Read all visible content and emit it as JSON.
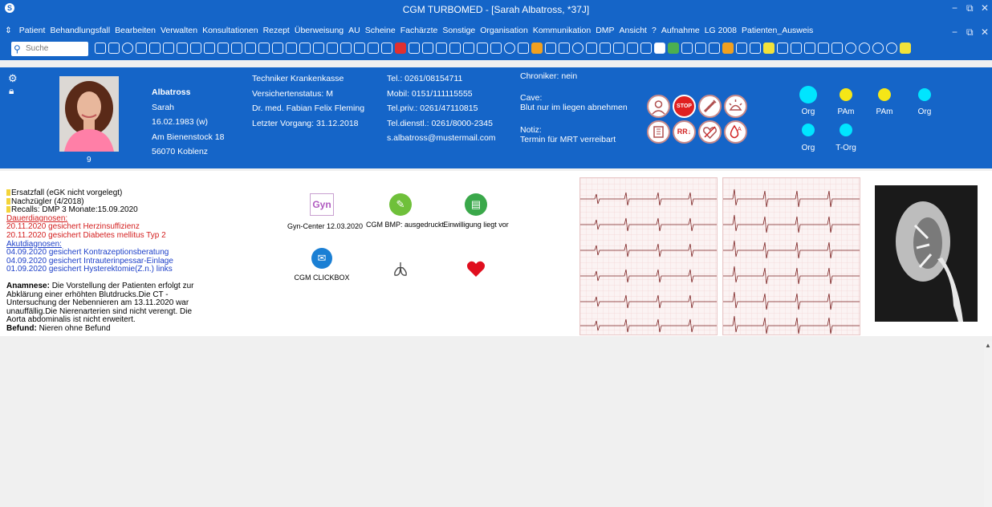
{
  "window": {
    "title": "CGM TURBOMED - [Sarah Albatross, *37J]",
    "minimize": "−",
    "restore": "⧉",
    "close": "✕"
  },
  "menu": {
    "items": [
      "Patient",
      "Behandlungsfall",
      "Bearbeiten",
      "Verwalten",
      "Konsultationen",
      "Rezept",
      "Überweisung",
      "AU",
      "Scheine",
      "Fachärzte",
      "Sonstige",
      "Organisation",
      "Kommunikation",
      "DMP",
      "Ansicht",
      "?",
      "Aufnahme",
      "LG 2008",
      "Patienten_Ausweis"
    ],
    "minimize": "−",
    "restore": "⧉",
    "close": "✕"
  },
  "toolbar": {
    "search_placeholder": "Suche"
  },
  "patient": {
    "photo_number": "9",
    "personal": {
      "surname": "Albatross",
      "firstname": "Sarah",
      "birthdate": "16.02.1983 (w)",
      "street": "Am Bienenstock 18",
      "city": "56070 Koblenz"
    },
    "insurance": {
      "company": "Techniker Krankenkasse",
      "status": "Versichertenstatus: M",
      "doctor": "Dr. med. Fabian Felix Fleming",
      "last_visit": "Letzter Vorgang: 31.12.2018"
    },
    "contact": {
      "tel": "Tel.: 0261/08154711",
      "mobile": "Mobil: 0151/111115555",
      "tel_priv": "Tel.priv.: 0261/47110815",
      "tel_dienst": "Tel.dienstl.: 0261/8000-2345",
      "email": "s.albatross@mustermail.com"
    },
    "notes": {
      "chroniker": "Chroniker: nein",
      "cave_label": "Cave:",
      "cave_text": "Blut nur im liegen abnehmen",
      "notiz_label": "Notiz:",
      "notiz_text": "Termin für MRT verreibart"
    },
    "statuses": [
      {
        "label": "Org",
        "color": "#00e5ff"
      },
      {
        "label": "PAm",
        "color": "#f5e617"
      },
      {
        "label": "PAm",
        "color": "#f5e617"
      },
      {
        "label": "Org",
        "color": "#00e5ff"
      },
      {
        "label": "Org",
        "color": "#00e5ff"
      },
      {
        "label": "T-Org",
        "color": "#00e5ff"
      }
    ],
    "indicator_icons": [
      "nurse-icon",
      "stop-icon",
      "syringe-icon",
      "sun-icon",
      "book-icon",
      "rr-down-icon",
      "heart-cross-icon",
      "blood-drop-icon"
    ],
    "rr_text": "RR↓",
    "stop_text": "STOP"
  },
  "content": {
    "info_lines": [
      "Ersatzfall (eGK nicht vorgelegt)",
      "Nachzügler (4/2018)",
      "Recalls: DMP 3 Monate:15.09.2020"
    ],
    "dauer_label": "Dauerdiagnosen:",
    "dauer": [
      "20.11.2020 gesichert Herzinsuffizienz",
      "20.11.2020 gesichert Diabetes mellitus Typ 2"
    ],
    "akut_label": "Akutdiagnosen:",
    "akut": [
      "04.09.2020 gesichert Kontrazeptionsberatung",
      "04.09.2020 gesichert Intrauterinpessar-Einlage",
      "01.09.2020 gesichert Hysterektomie(Z.n.) links"
    ],
    "anamnese_label": "Anamnese:",
    "anamnese_text": "Die Vorstellung der Patienten erfolgt zur Abklärung einer erhöhten Blutdrucks.Die CT - Untersuchung der Nebennieren am 13.11.2020 war unauffällig.Die Nierenarterien sind nicht verengt. Die Aorta abdominalis ist nicht erweitert.",
    "befund_label": "Befund:",
    "befund_text": "Nieren ohne Befund",
    "tiles": {
      "gyn_icon_text": "Gyn",
      "gyn_caption": "Gyn-Center 12.03.2020",
      "bmp_caption": "CGM BMP: ausgedruckt",
      "einwilligung_caption": "Einwilligung liegt vor",
      "clickbox_caption": "CGM CLICKBOX"
    }
  }
}
